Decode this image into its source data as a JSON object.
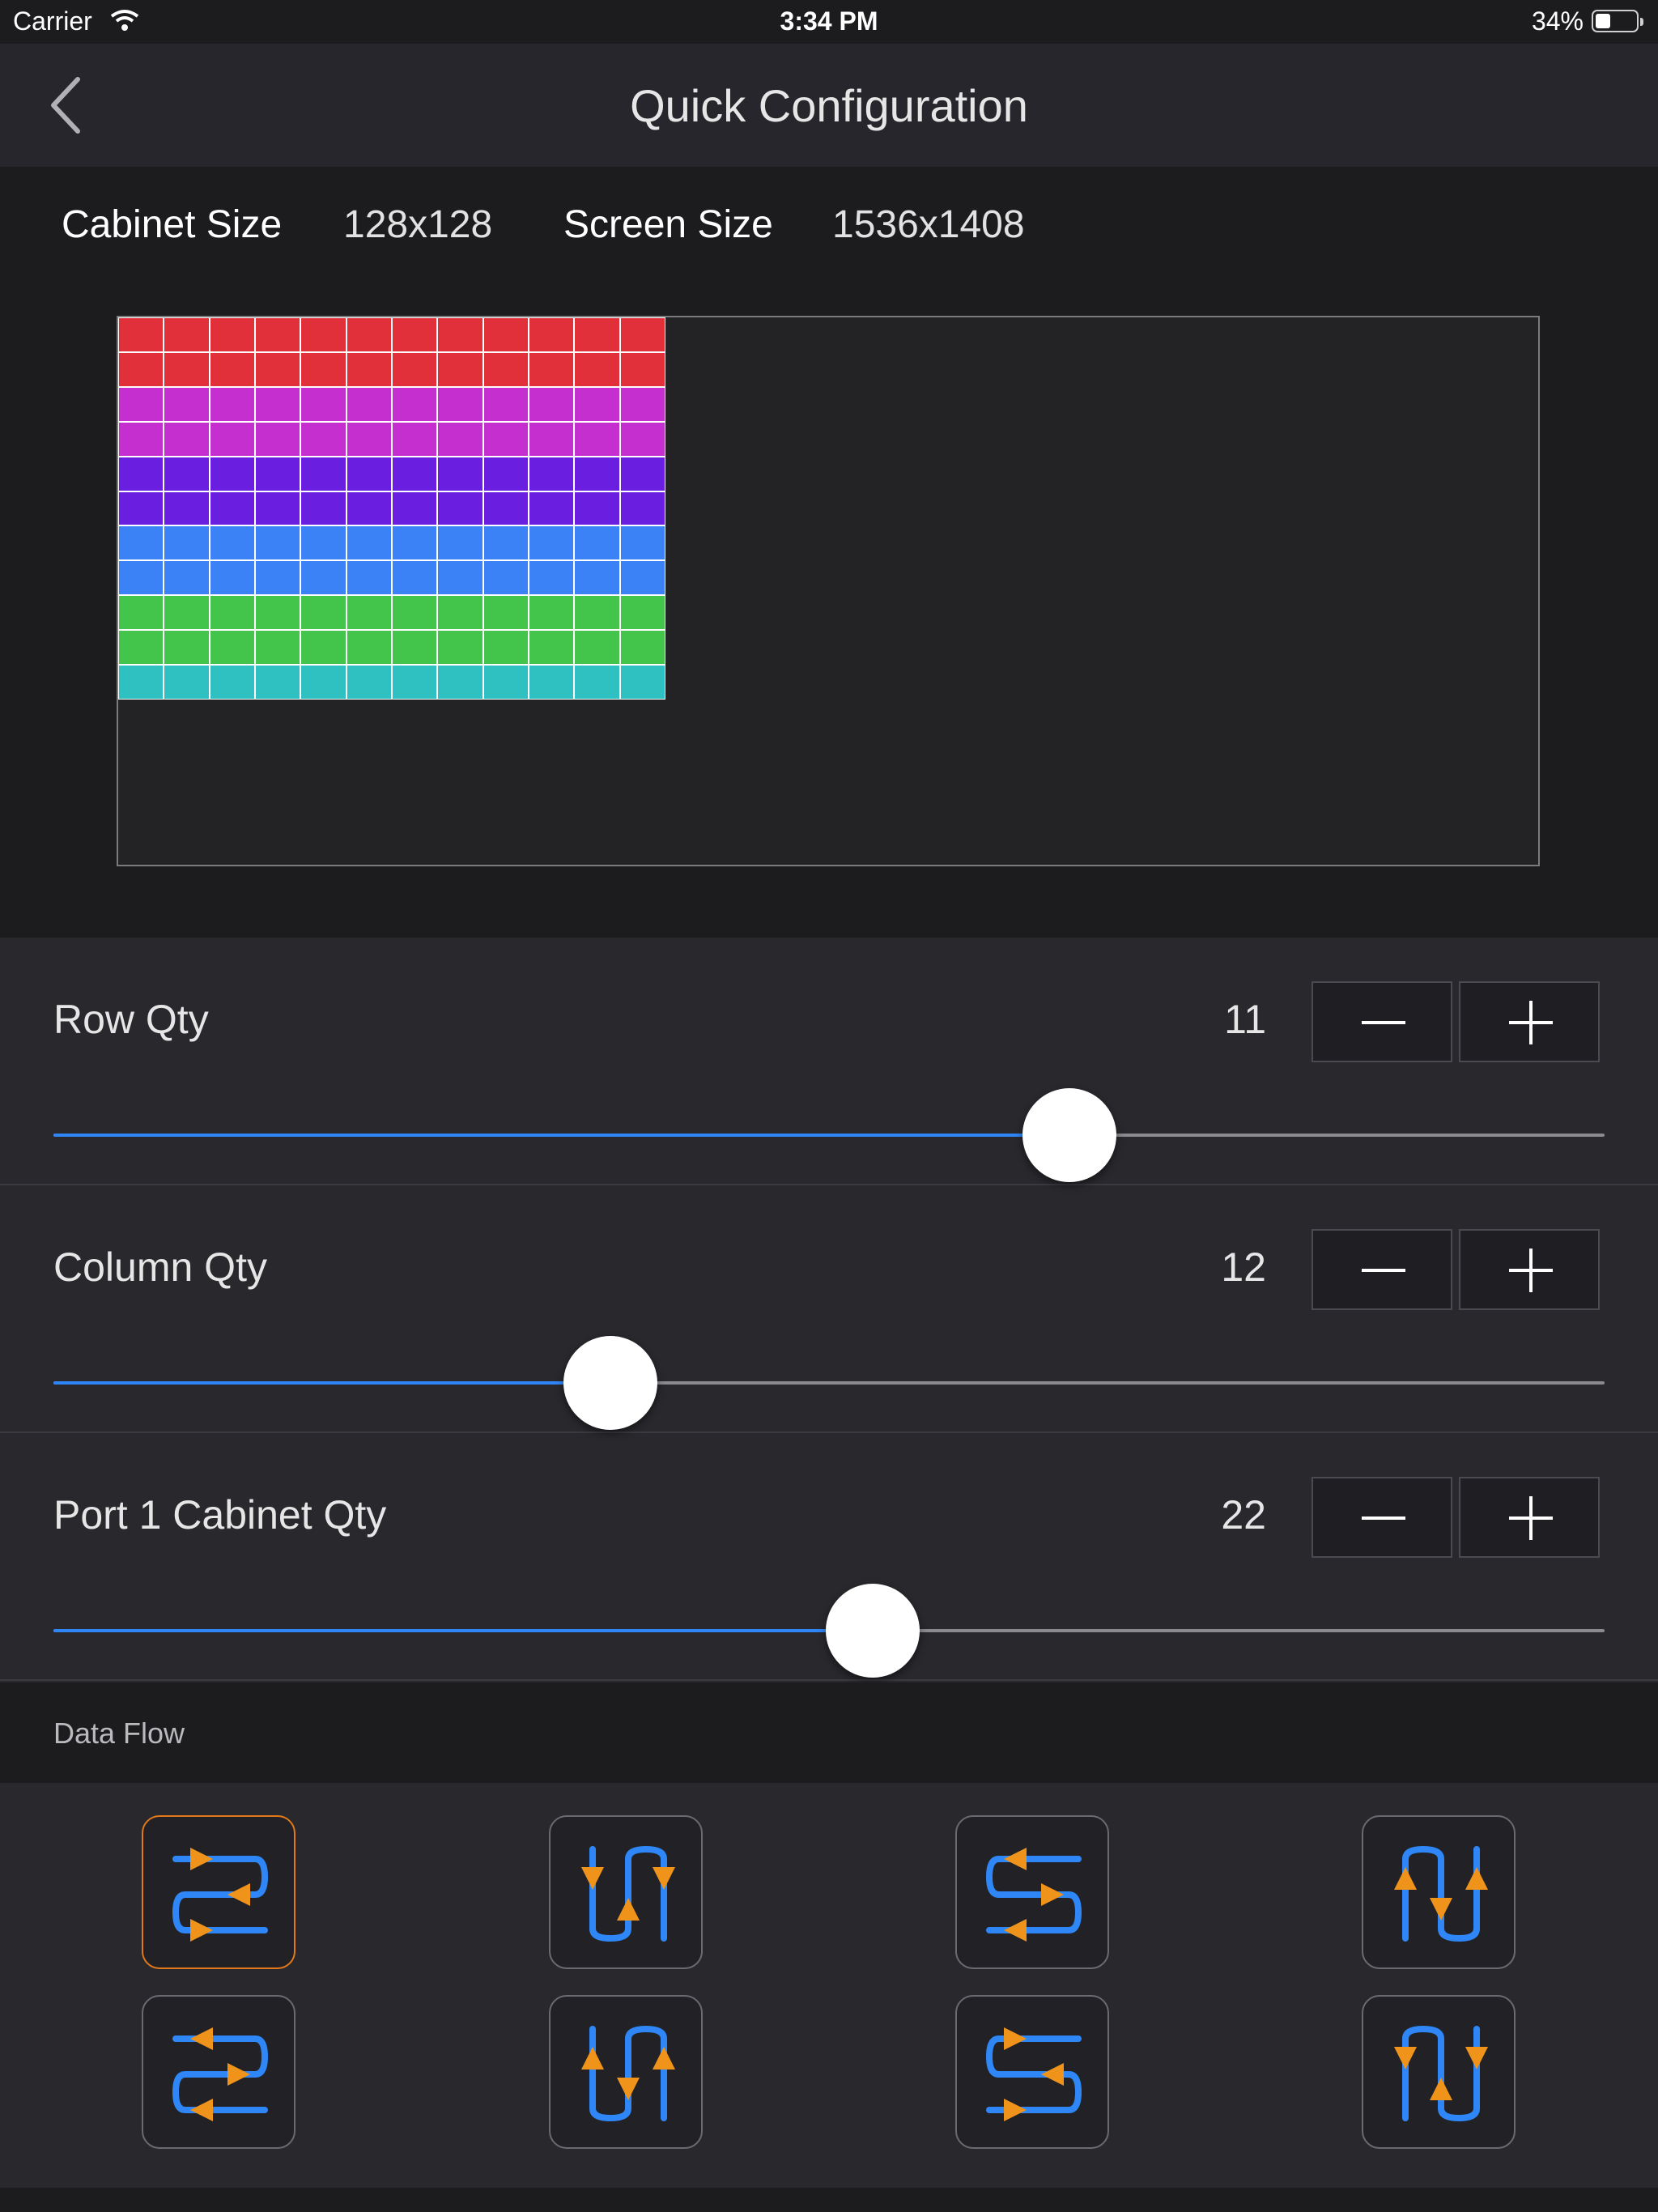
{
  "status_bar": {
    "carrier": "Carrier",
    "time": "3:34 PM",
    "battery_percent": "34%",
    "battery_level": 0.34
  },
  "nav": {
    "title": "Quick Configuration"
  },
  "sizes": {
    "cabinet_label": "Cabinet Size",
    "cabinet_value": "128x128",
    "screen_label": "Screen Size",
    "screen_value": "1536x1408"
  },
  "preview": {
    "columns": 12,
    "rows": 11,
    "row_colors": [
      "#e2303a",
      "#e2303a",
      "#c62fcf",
      "#c62fcf",
      "#6a1ee0",
      "#6a1ee0",
      "#3b82f6",
      "#3b82f6",
      "#43c44a",
      "#43c44a",
      "#2fc1c1"
    ]
  },
  "controls": [
    {
      "label": "Row Qty",
      "value": "11",
      "slider_fraction": 0.655
    },
    {
      "label": "Column Qty",
      "value": "12",
      "slider_fraction": 0.359
    },
    {
      "label": "Port 1 Cabinet Qty",
      "value": "22",
      "slider_fraction": 0.528
    }
  ],
  "data_flow": {
    "header": "Data Flow",
    "options": [
      {
        "name": "horizontal-snake-right-start",
        "selected": true
      },
      {
        "name": "vertical-snake-up-down-a",
        "selected": false
      },
      {
        "name": "horizontal-snake-left-start",
        "selected": false
      },
      {
        "name": "vertical-snake-down-up-a",
        "selected": false
      },
      {
        "name": "horizontal-snake-right-alt",
        "selected": false
      },
      {
        "name": "vertical-snake-up-down-b",
        "selected": false
      },
      {
        "name": "horizontal-snake-left-alt",
        "selected": false
      },
      {
        "name": "vertical-snake-down-up-b",
        "selected": false
      }
    ]
  },
  "colors": {
    "accent_blue": "#2f86f6",
    "selected_orange": "#e27819",
    "arrow_orange": "#f0931a"
  }
}
